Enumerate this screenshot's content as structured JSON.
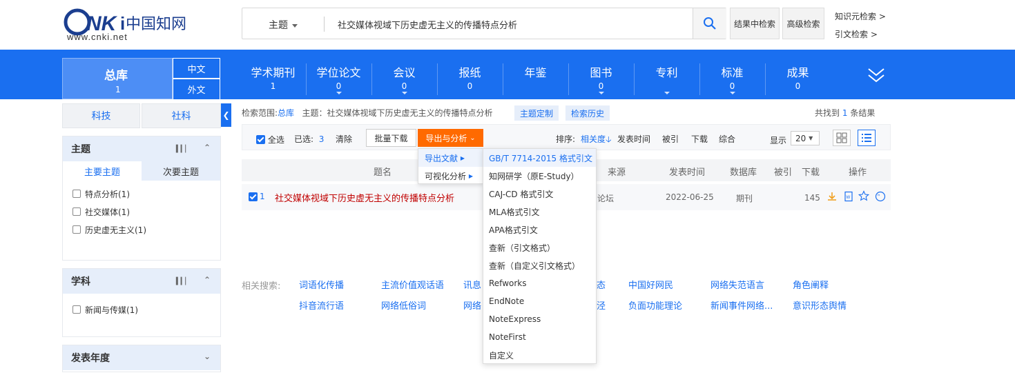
{
  "header": {
    "logo_text": "CNKi中国知网",
    "logo_url_text": "www.cnki.net",
    "search_type": "主题",
    "search_value": "社交媒体视域下历史虚无主义的传播特点分析",
    "result_search_btn": "结果中检索",
    "advanced_search_btn": "高级检索",
    "knowledge_link": "知识元检索 >",
    "citation_link": "引文检索 >"
  },
  "nav": {
    "zongku": {
      "label": "总库",
      "count": "1"
    },
    "lang_zh": "中文",
    "lang_en": "外文",
    "categories": [
      {
        "label": "学术期刊",
        "count": "1"
      },
      {
        "label": "学位论文",
        "count": "0"
      },
      {
        "label": "会议",
        "count": "0"
      },
      {
        "label": "报纸",
        "count": "0"
      },
      {
        "label": "年鉴",
        "count": ""
      },
      {
        "label": "图书",
        "count": "0"
      },
      {
        "label": "专利",
        "count": ""
      },
      {
        "label": "标准",
        "count": "0"
      },
      {
        "label": "成果",
        "count": "0"
      }
    ]
  },
  "sidebar": {
    "tab_sci": "科技",
    "tab_soc": "社科",
    "topic_panel": {
      "title": "主题",
      "sub_main": "主要主题",
      "sub_secondary": "次要主题",
      "items": [
        "特点分析(1)",
        "社交媒体(1)",
        "历史虚无主义(1)"
      ]
    },
    "discipline_panel": {
      "title": "学科",
      "items": [
        "新闻与传媒(1)"
      ]
    },
    "year_panel": {
      "title": "发表年度"
    }
  },
  "main": {
    "crumb_prefix": "检索范围:",
    "crumb_scope": "总库",
    "crumb_query": "主题：社交媒体视域下历史虚无主义的传播特点分析",
    "topic_custom_btn": "主题定制",
    "search_history_btn": "检索历史",
    "total_prefix": "共找到",
    "total_count": "1",
    "total_suffix": "条结果",
    "select_all": "全选",
    "selected_label": "已选:",
    "selected_count": "3",
    "clear": "清除",
    "batch_download": "批量下载",
    "export_analysis": "导出与分析",
    "sort_label": "排序:",
    "sort_relevance": "相关度",
    "sort_date": "发表时间",
    "sort_cited": "被引",
    "sort_download": "下载",
    "sort_composite": "综合",
    "display_label": "显示",
    "page_size": "20",
    "columns": {
      "title": "题名",
      "source": "来源",
      "date": "发表时间",
      "db": "数据库",
      "cited": "被引",
      "downloads": "下载",
      "ops": "操作"
    },
    "rows": [
      {
        "index": "1",
        "title": "社交媒体视域下历史虚无主义的传播特点分析",
        "source_partial": "论坛",
        "date": "2022-06-25",
        "db": "期刊",
        "downloads": "145"
      }
    ]
  },
  "submenu": {
    "items": [
      "导出文献",
      "可视化分析"
    ]
  },
  "flyout": {
    "items": [
      "GB/T 7714-2015 格式引文",
      "知网研学（原E-Study）",
      "CAJ-CD 格式引文",
      "MLA格式引文",
      "APA格式引文",
      "查新（引文格式）",
      "查新（自定义引文格式）",
      "Refworks",
      "EndNote",
      "NoteExpress",
      "NoteFirst",
      "自定义"
    ]
  },
  "related": {
    "label": "相关搜索:",
    "row1": [
      "词语化传播",
      "主流价值观话语",
      "讯息",
      "态",
      "中国好网民",
      "网络失范语言",
      "角色阐释"
    ],
    "row2": [
      "抖音流行语",
      "网络低俗词",
      "网络",
      "泾",
      "负面功能理论",
      "新闻事件网络...",
      "意识形态舆情"
    ]
  },
  "colors": {
    "brand_blue": "#1a6ff0",
    "accent_orange": "#ff6a00",
    "title_red": "#c00000"
  }
}
